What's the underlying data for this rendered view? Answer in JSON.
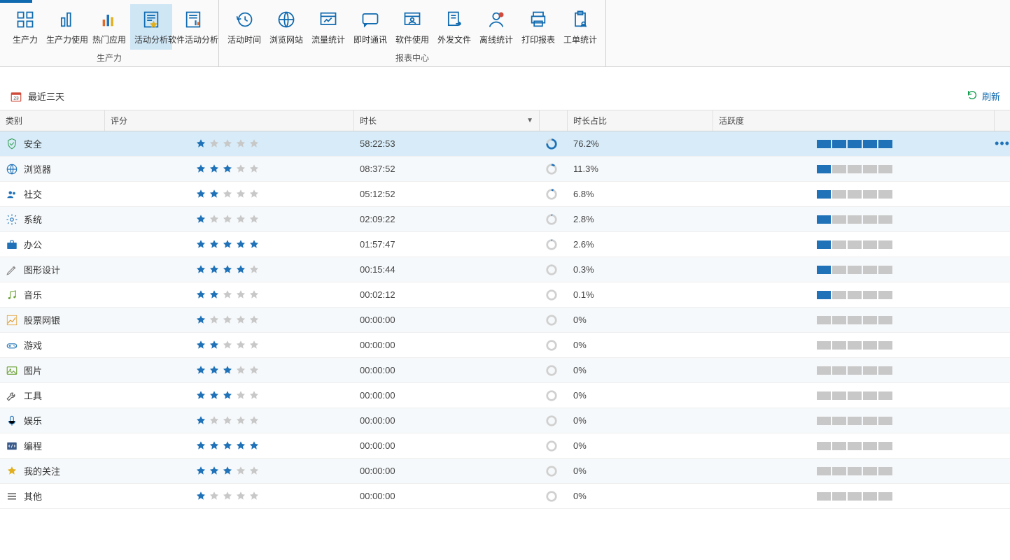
{
  "ribbon": {
    "groups": [
      {
        "label": "生产力",
        "items": [
          {
            "id": "productivity",
            "label": "生产力",
            "icon": "grid",
            "active": false
          },
          {
            "id": "productivity-usage",
            "label": "生产力使用",
            "icon": "bar",
            "active": false
          },
          {
            "id": "popular-apps",
            "label": "热门应用",
            "icon": "bars-3",
            "active": false
          },
          {
            "id": "activity-analysis",
            "label": "活动分析",
            "icon": "doc-star",
            "active": true
          },
          {
            "id": "software-activity",
            "label": "软件活动分析",
            "icon": "doc-bar",
            "active": false
          }
        ]
      },
      {
        "label": "报表中心",
        "items": [
          {
            "id": "activity-time",
            "label": "活动时间",
            "icon": "clock-back",
            "active": false
          },
          {
            "id": "browse-website",
            "label": "浏览网站",
            "icon": "globe",
            "active": false
          },
          {
            "id": "traffic-stats",
            "label": "流量统计",
            "icon": "window-chart",
            "active": false
          },
          {
            "id": "instant-messaging",
            "label": "即时通讯",
            "icon": "chat",
            "active": false
          },
          {
            "id": "software-usage",
            "label": "软件使用",
            "icon": "window-user",
            "active": false
          },
          {
            "id": "outgoing-files",
            "label": "外发文件",
            "icon": "doc-out",
            "active": false
          },
          {
            "id": "offline-stats",
            "label": "离线统计",
            "icon": "person-dot",
            "active": false
          },
          {
            "id": "print-report",
            "label": "打印报表",
            "icon": "printer",
            "active": false
          },
          {
            "id": "ticket-stats",
            "label": "工单统计",
            "icon": "clipboard-user",
            "active": false
          }
        ]
      }
    ]
  },
  "subbar": {
    "date_label": "最近三天",
    "calendar_day": "23",
    "refresh_label": "刷新"
  },
  "columns": {
    "category": "类别",
    "rating": "评分",
    "duration": "时长",
    "duration_pct": "时长占比",
    "activity": "活跃度"
  },
  "rows": [
    {
      "icon": "shield",
      "icon_color": "#3aa15a",
      "category": "安全",
      "rating": 1,
      "duration": "58:22:53",
      "pct": 76.2,
      "pct_label": "76.2%",
      "activity": 5,
      "selected": true
    },
    {
      "icon": "globe",
      "icon_color": "#1f72b8",
      "category": "浏览器",
      "rating": 3,
      "duration": "08:37:52",
      "pct": 11.3,
      "pct_label": "11.3%",
      "activity": 1,
      "selected": false
    },
    {
      "icon": "users",
      "icon_color": "#1f72b8",
      "category": "社交",
      "rating": 2,
      "duration": "05:12:52",
      "pct": 6.8,
      "pct_label": "6.8%",
      "activity": 1,
      "selected": false
    },
    {
      "icon": "gear",
      "icon_color": "#1f72b8",
      "category": "系统",
      "rating": 1,
      "duration": "02:09:22",
      "pct": 2.8,
      "pct_label": "2.8%",
      "activity": 1,
      "selected": false
    },
    {
      "icon": "briefcase",
      "icon_color": "#1f72b8",
      "category": "办公",
      "rating": 5,
      "duration": "01:57:47",
      "pct": 2.6,
      "pct_label": "2.6%",
      "activity": 1,
      "selected": false
    },
    {
      "icon": "pen",
      "icon_color": "#888",
      "category": "图形设计",
      "rating": 4,
      "duration": "00:15:44",
      "pct": 0.3,
      "pct_label": "0.3%",
      "activity": 1,
      "selected": false
    },
    {
      "icon": "music",
      "icon_color": "#6ea23a",
      "category": "音乐",
      "rating": 2,
      "duration": "00:02:12",
      "pct": 0.1,
      "pct_label": "0.1%",
      "activity": 1,
      "selected": false
    },
    {
      "icon": "stock",
      "icon_color": "#e09a2a",
      "category": "股票网银",
      "rating": 1,
      "duration": "00:00:00",
      "pct": 0,
      "pct_label": "0%",
      "activity": 0,
      "selected": false
    },
    {
      "icon": "gamepad",
      "icon_color": "#1f72b8",
      "category": "游戏",
      "rating": 2,
      "duration": "00:00:00",
      "pct": 0,
      "pct_label": "0%",
      "activity": 0,
      "selected": false
    },
    {
      "icon": "image",
      "icon_color": "#6ea23a",
      "category": "图片",
      "rating": 3,
      "duration": "00:00:00",
      "pct": 0,
      "pct_label": "0%",
      "activity": 0,
      "selected": false
    },
    {
      "icon": "wrench",
      "icon_color": "#555",
      "category": "工具",
      "rating": 3,
      "duration": "00:00:00",
      "pct": 0,
      "pct_label": "0%",
      "activity": 0,
      "selected": false
    },
    {
      "icon": "mic",
      "icon_color": "#1f72b8",
      "category": "娱乐",
      "rating": 1,
      "duration": "00:00:00",
      "pct": 0,
      "pct_label": "0%",
      "activity": 0,
      "selected": false
    },
    {
      "icon": "code",
      "icon_color": "#3a5a8a",
      "category": "编程",
      "rating": 5,
      "duration": "00:00:00",
      "pct": 0,
      "pct_label": "0%",
      "activity": 0,
      "selected": false
    },
    {
      "icon": "star",
      "icon_color": "#e0b020",
      "category": "我的关注",
      "rating": 3,
      "duration": "00:00:00",
      "pct": 0,
      "pct_label": "0%",
      "activity": 0,
      "selected": false
    },
    {
      "icon": "menu",
      "icon_color": "#555",
      "category": "其他",
      "rating": 1,
      "duration": "00:00:00",
      "pct": 0,
      "pct_label": "0%",
      "activity": 0,
      "selected": false
    }
  ]
}
